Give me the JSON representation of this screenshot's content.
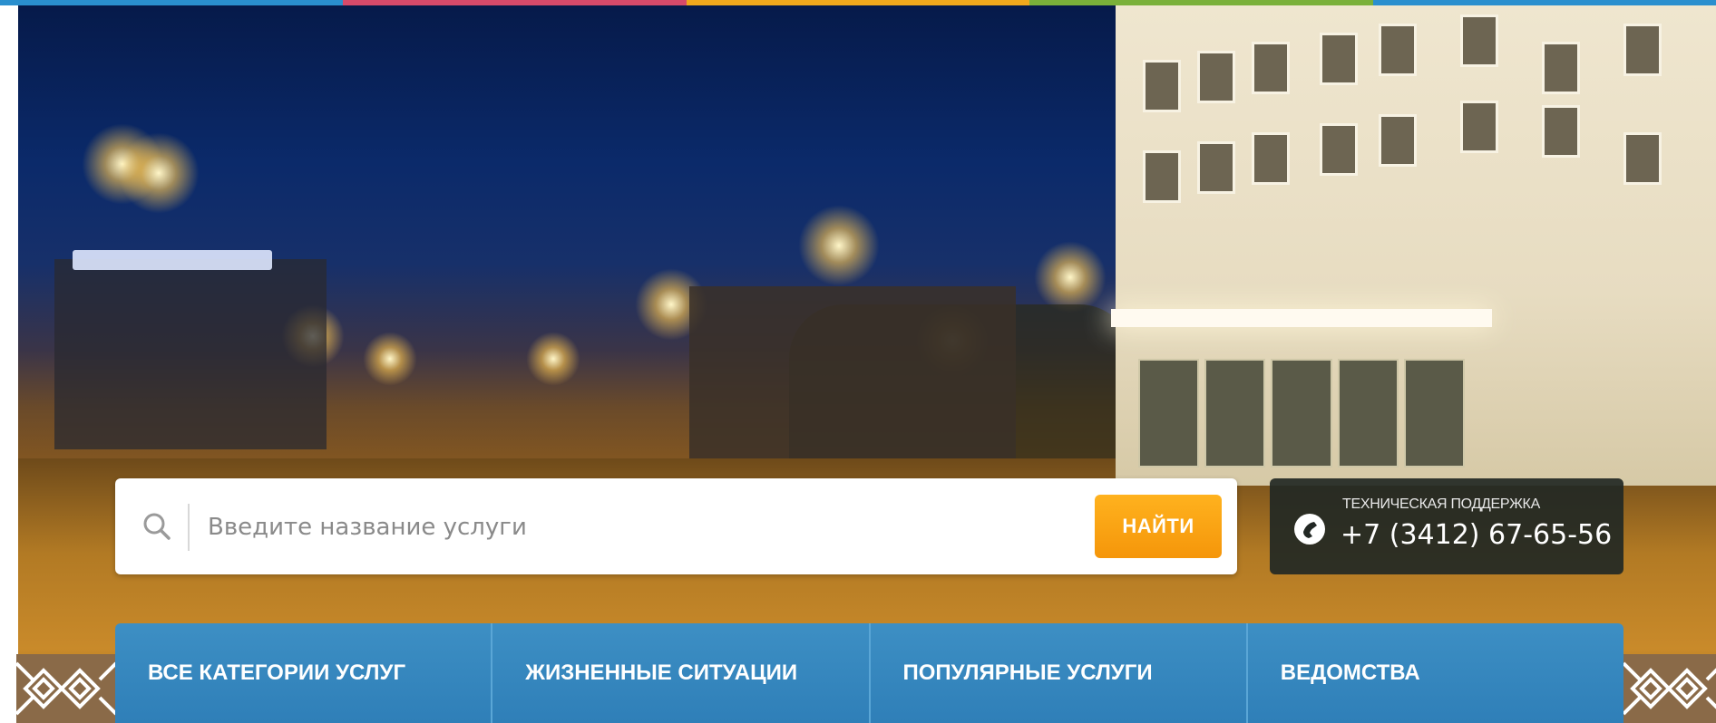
{
  "top_strip_colors": [
    "#2a8fce",
    "#d64a6a",
    "#f0a81c",
    "#7ab03a",
    "#2a8fce"
  ],
  "hero": {
    "image": "night-city-street-photo"
  },
  "search": {
    "icon": "search-icon",
    "placeholder": "Введите название услуги",
    "value": "",
    "button_label": "НАЙТИ",
    "button_color": "#f5960a"
  },
  "support": {
    "icon": "phone-icon",
    "label": "ТЕХНИЧЕСКАЯ ПОДДЕРЖКА",
    "phone": "+7 (3412) 67-65-56"
  },
  "nav": {
    "background": "#2f7fb8",
    "items": [
      {
        "label": "ВСЕ КАТЕГОРИИ УСЛУГ"
      },
      {
        "label": "ЖИЗНЕННЫЕ СИТУАЦИИ"
      },
      {
        "label": "ПОПУЛЯРНЫЕ УСЛУГИ"
      },
      {
        "label": "ВЕДОМСТВА"
      }
    ]
  },
  "ornaments": [
    "ornament-icon",
    "ornament-icon"
  ]
}
